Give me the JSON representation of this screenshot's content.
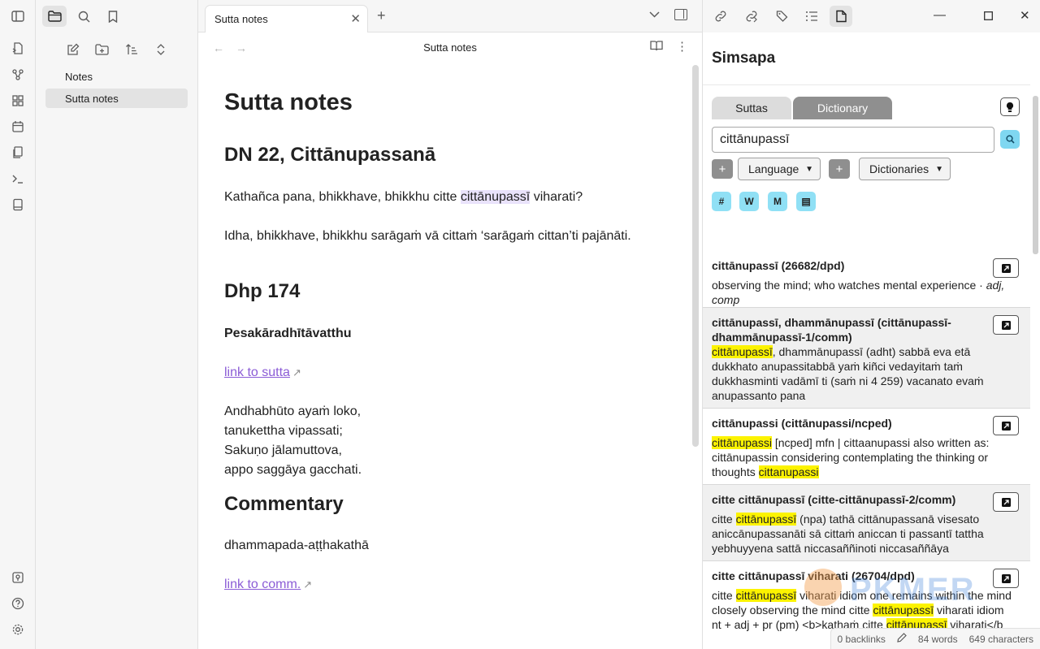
{
  "ribbon": {
    "icons": [
      "toggle-sidebar-icon",
      "open-quick-switcher-icon",
      "graph-view-icon",
      "canvas-icon",
      "daily-note-icon",
      "templates-icon",
      "command-palette-icon",
      "book-icon"
    ],
    "bottom_icons": [
      "vault-switch-icon",
      "help-icon",
      "settings-icon"
    ]
  },
  "explorer": {
    "items": [
      {
        "label": "Notes",
        "active": false
      },
      {
        "label": "Sutta notes",
        "active": true
      }
    ]
  },
  "editor": {
    "tab_title": "Sutta notes",
    "view_title": "Sutta notes",
    "doc": {
      "h1": "Sutta notes",
      "h2_1": "DN 22, Cittānupassanā",
      "p1_pre": "Kathañca pana, bhikkhave, bhikkhu citte ",
      "p1_sel": "cittānupassī",
      "p1_post": " viharati?",
      "p2": "Idha, bhikkhave, bhikkhu sarāgaṁ vā cittaṁ ‘sarāgaṁ cittan’ti pajānāti.",
      "h2_2": "Dhp 174",
      "p3": "Pesakāradhītāvatthu",
      "link1": "link to sutta",
      "verse": [
        "Andhabhūto ayaṁ loko,",
        "tanukettha vipassati;",
        "Sakuṇo jālamuttova,",
        "appo saggāya gacchati."
      ],
      "h2_3": "Commentary",
      "p4": "dhammapada-aṭṭhakathā",
      "link2": "link to comm."
    }
  },
  "sidebar": {
    "title": "Simsapa",
    "tabs": {
      "suttas": "Suttas",
      "dictionary": "Dictionary"
    },
    "search_value": "cittānupassī",
    "language_select": "Language",
    "dictionaries_select": "Dictionaries",
    "chips": [
      "#",
      "W",
      "M",
      "▤"
    ],
    "results": [
      {
        "title": "cittānupassī (26682/dpd)",
        "body_parts": [
          {
            "t": "observing the mind; who watches mental experience · ",
            "h": false
          },
          {
            "t": "adj, comp",
            "h": false,
            "i": true
          }
        ]
      },
      {
        "title": "cittānupassī, dhammānupassī (cittānupassī-dhammānupassī-1/comm)",
        "body_parts": [
          {
            "t": "cittānupassī",
            "h": true
          },
          {
            "t": ", dhammānupassī (adht) sabbā eva etā dukkhato anupassitabbā yaṁ kiñci vedayitaṁ taṁ dukkhasminti vadāmī ti (saṁ ni 4 259) vacanato evaṁ anupassanto pana",
            "h": false
          }
        ]
      },
      {
        "title": "cittānupassi (cittānupassi/ncped)",
        "body_parts": [
          {
            "t": "cittānupassi",
            "h": true
          },
          {
            "t": " [ncped] mfn | cittaanupassi also written as: cittānupassin considering contemplating the thinking or thoughts ",
            "h": false
          },
          {
            "t": "cittanupassi",
            "h": true
          }
        ]
      },
      {
        "title": "citte cittānupassī (citte-cittānupassī-2/comm)",
        "body_parts": [
          {
            "t": "citte ",
            "h": false
          },
          {
            "t": "cittānupassī",
            "h": true
          },
          {
            "t": " (npa) tathā cittānupassanā visesato aniccānupassanāti sā cittaṁ aniccan ti passantī tattha yebhuyyena sattā niccasaññinoti niccasaññāya",
            "h": false
          }
        ]
      },
      {
        "title": "citte cittānupassī viharati (26704/dpd)",
        "body_parts": [
          {
            "t": "citte ",
            "h": false
          },
          {
            "t": "cittānupassī",
            "h": true
          },
          {
            "t": " viharati idiom one remains within the mind closely observing the mind citte ",
            "h": false
          },
          {
            "t": "cittānupassī",
            "h": true
          },
          {
            "t": " viharati idiom nt + adj + pr (pm) <b>kathaṁ citte ",
            "h": false
          },
          {
            "t": "cittānupassī",
            "h": true
          },
          {
            "t": " viharati</b",
            "h": false
          }
        ]
      }
    ]
  },
  "status": {
    "backlinks": "0 backlinks",
    "words": "84 words",
    "characters": "649 characters"
  },
  "watermark": "PKMER"
}
